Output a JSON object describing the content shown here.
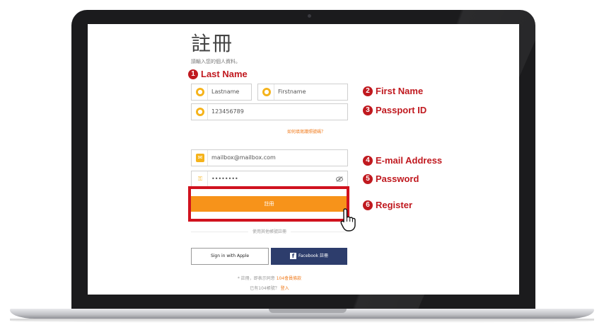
{
  "form": {
    "title": "註冊",
    "subtitle": "請輸入您的個人資料。",
    "last_name_value": "Lastname",
    "first_name_value": "Firstname",
    "passport_value": "123456789",
    "hint_link": "如何填寫護照號碼？",
    "email_value": "mailbox@mailbox.com",
    "password_value": "••••••••",
    "register_label": "註冊",
    "or_text": "使用其他帳號註冊",
    "apple_label": "Sign in with Apple",
    "facebook_label": "Facebook 註冊",
    "terms_prefix": "* 註冊，即表示同意",
    "terms_link": "104會員條款",
    "login_prefix": "已有104帳號？",
    "login_link": "登入"
  },
  "annotations": [
    {
      "num": "1",
      "label": "Last Name"
    },
    {
      "num": "2",
      "label": "First Name"
    },
    {
      "num": "3",
      "label": "Passport ID"
    },
    {
      "num": "4",
      "label": "E-mail Address"
    },
    {
      "num": "5",
      "label": "Password"
    },
    {
      "num": "6",
      "label": "Register"
    }
  ],
  "colors": {
    "accent": "#f7931a",
    "annotation": "#c0191f",
    "facebook": "#2d3d6c"
  }
}
